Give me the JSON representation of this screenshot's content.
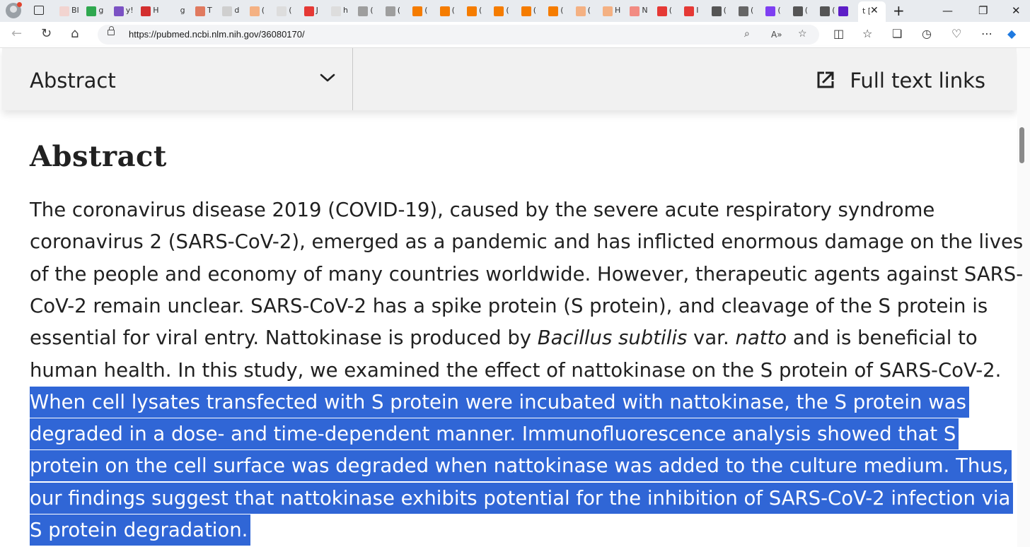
{
  "browser": {
    "tabs": [
      {
        "fav_color": "#f2d4d0",
        "letter": "BI"
      },
      {
        "fav_color": "#2fa84f",
        "letter": "g"
      },
      {
        "fav_color": "#7b52c4",
        "letter": "y!"
      },
      {
        "fav_color": "#d32f2f",
        "letter": "H"
      },
      {
        "fav_color": "#e8ebef",
        "letter": "g"
      },
      {
        "fav_color": "#e07a5f",
        "letter": "T"
      },
      {
        "fav_color": "#cfcfcf",
        "letter": "d"
      },
      {
        "fav_color": "#f4b183",
        "letter": "("
      },
      {
        "fav_color": "#dddddd",
        "letter": "("
      },
      {
        "fav_color": "#e53935",
        "letter": "J"
      },
      {
        "fav_color": "#dddddd",
        "letter": "h"
      },
      {
        "fav_color": "#9e9e9e",
        "letter": "("
      },
      {
        "fav_color": "#9e9e9e",
        "letter": "("
      },
      {
        "fav_color": "#f57c00",
        "letter": "("
      },
      {
        "fav_color": "#f57c00",
        "letter": "("
      },
      {
        "fav_color": "#f57c00",
        "letter": "("
      },
      {
        "fav_color": "#f57c00",
        "letter": "("
      },
      {
        "fav_color": "#f57c00",
        "letter": "("
      },
      {
        "fav_color": "#f57c00",
        "letter": "("
      },
      {
        "fav_color": "#f4b183",
        "letter": "("
      },
      {
        "fav_color": "#f4b183",
        "letter": "H"
      },
      {
        "fav_color": "#f28b82",
        "letter": "N"
      },
      {
        "fav_color": "#e53935",
        "letter": "("
      },
      {
        "fav_color": "#e53935",
        "letter": "I"
      },
      {
        "fav_color": "#555555",
        "letter": "("
      },
      {
        "fav_color": "#666666",
        "letter": "("
      },
      {
        "fav_color": "#7e3ff2",
        "letter": "("
      },
      {
        "fav_color": "#555555",
        "letter": "("
      },
      {
        "fav_color": "#555555",
        "letter": "("
      }
    ],
    "active_tab_label": "t [",
    "close_glyph": "✕",
    "newtab_glyph": "+",
    "minimize_glyph": "—",
    "restore_glyph": "❐",
    "url": "https://pubmed.ncbi.nlm.nih.gov/36080170/"
  },
  "header": {
    "section_select": "Abstract",
    "full_text_links": "Full text links"
  },
  "abstract": {
    "heading": "Abstract",
    "lines": [
      {
        "parts": [
          {
            "t": "The coronavirus disease 2019 (COVID-19), caused by the severe acute respiratory syndrome"
          }
        ]
      },
      {
        "parts": [
          {
            "t": "coronavirus 2 (SARS-CoV-2), emerged as a pandemic and has inflicted enormous damage on the lives"
          }
        ]
      },
      {
        "parts": [
          {
            "t": "of the people and economy of many countries worldwide. However, therapeutic agents against SARS-"
          }
        ]
      },
      {
        "parts": [
          {
            "t": "CoV-2 remain unclear. SARS-CoV-2 has a spike protein (S protein), and cleavage of the S protein is"
          }
        ]
      },
      {
        "parts": [
          {
            "t": "essential for viral entry. Nattokinase is produced by "
          },
          {
            "t": "Bacillus subtilis",
            "i": true
          },
          {
            "t": " var. "
          },
          {
            "t": "natto",
            "i": true
          },
          {
            "t": " and is beneficial to"
          }
        ]
      },
      {
        "parts": [
          {
            "t": "human health. In this study, we examined the effect of nattokinase on the S protein of SARS-CoV-2."
          }
        ]
      },
      {
        "sel": true,
        "parts": [
          {
            "t": "When cell lysates transfected with S protein were incubated with nattokinase, the S protein was"
          }
        ]
      },
      {
        "sel": true,
        "parts": [
          {
            "t": "degraded in a dose- and time-dependent manner. Immunofluorescence analysis showed that S"
          }
        ]
      },
      {
        "sel": true,
        "parts": [
          {
            "t": "protein on the cell surface was degraded when nattokinase was added to the culture medium. Thus,"
          }
        ]
      },
      {
        "sel": true,
        "parts": [
          {
            "t": "our findings suggest that nattokinase exhibits potential for the inhibition of SARS-CoV-2 infection via"
          }
        ]
      },
      {
        "sel": true,
        "parts": [
          {
            "t": "S protein degradation."
          }
        ]
      }
    ]
  },
  "colors": {
    "selection": "#3066d6",
    "header_bg": "#f1f1f1",
    "text": "#212121"
  }
}
